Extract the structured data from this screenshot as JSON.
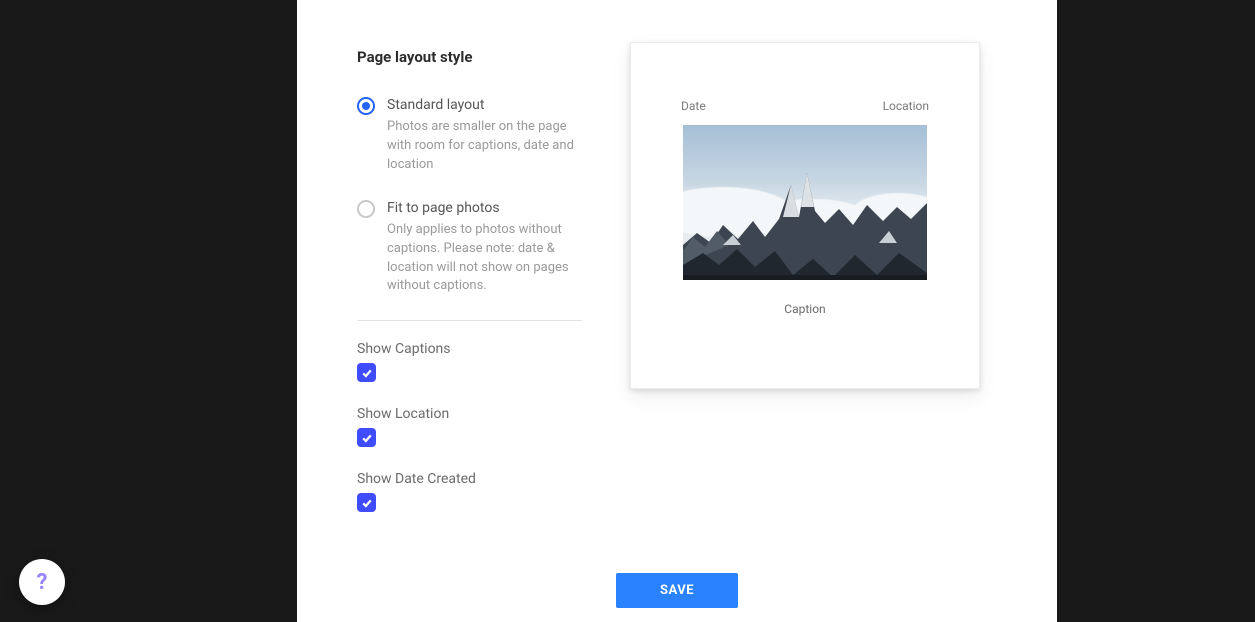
{
  "section_title": "Page layout style",
  "options": {
    "standard": {
      "title": "Standard layout",
      "desc": "Photos are smaller on the page with room for captions, date and location"
    },
    "fit": {
      "title": "Fit to page photos",
      "desc": "Only applies to photos without captions. Please note: date & location will not show on pages without captions."
    }
  },
  "checks": {
    "captions": "Show Captions",
    "location": "Show Location",
    "date_created": "Show Date Created"
  },
  "preview": {
    "date_label": "Date",
    "location_label": "Location",
    "caption_label": "Caption"
  },
  "save_label": "SAVE",
  "help_label": "?"
}
